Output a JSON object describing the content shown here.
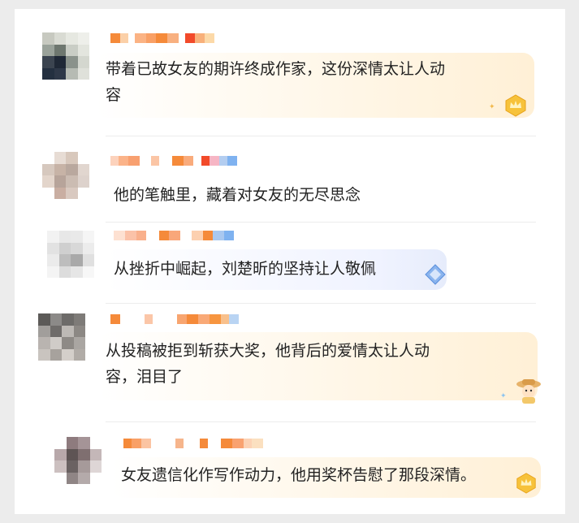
{
  "comments": [
    {
      "text": "带着已故女友的期许终成作家，这份深情太让人动\n容",
      "badge": "gold-crown-badge"
    },
    {
      "text": "他的笔触里，藏着对女友的无尽思念",
      "badge": ""
    },
    {
      "text": "从挫折中崛起，刘楚昕的坚持让人敬佩",
      "badge": "blue-diamond-badge"
    },
    {
      "text": "从投稿被拒到斩获大奖，他背后的爱情太让人动\n容，泪目了",
      "badge": "cartoon-avatar-badge"
    },
    {
      "text": "女友遗信化作写作动力，他用奖杯告慰了那段深情。",
      "badge": "gold-crown-badge"
    }
  ],
  "colors": {
    "page_bg": "#ececec",
    "card_bg": "#ffffff",
    "text": "#222222",
    "bubble_tint": "#fff0d6",
    "name_orange": "#f58a3a",
    "name_red": "#f24a2a",
    "name_blue": "#7fb2f0"
  }
}
